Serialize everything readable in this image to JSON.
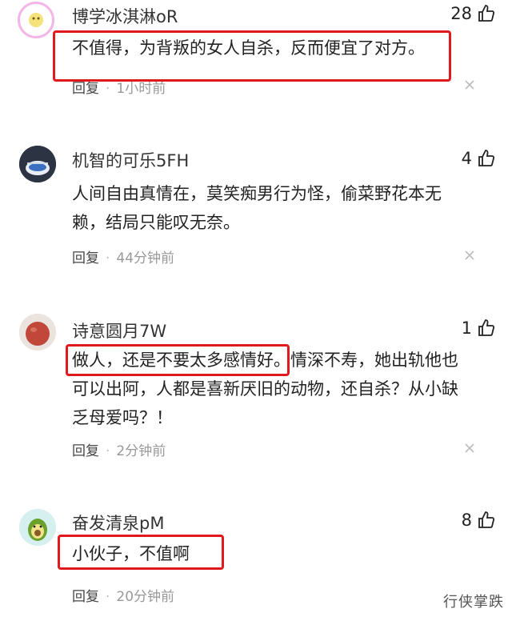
{
  "comments": [
    {
      "username": "博学冰淇淋oR",
      "likes": "28",
      "lines": [
        "不值得，为背叛的女人自杀，反而便宜了对方。"
      ],
      "reply_label": "回复",
      "time": "1小时前"
    },
    {
      "username": "机智的可乐5FH",
      "likes": "4",
      "lines": [
        "人间自由真情在，莫笑痴男行为怪，偷菜野花本无",
        "赖，结局只能叹无奈。"
      ],
      "reply_label": "回复",
      "time": "44分钟前"
    },
    {
      "username": "诗意圆月7W",
      "likes": "1",
      "lines": [
        "做人，还是不要太多感情好。情深不寿，她出轨他也",
        "可以出阿，人都是喜新厌旧的动物，还自杀？从小缺",
        "乏母爱吗？！"
      ],
      "reply_label": "回复",
      "time": "2分钟前"
    },
    {
      "username": "奋发清泉pM",
      "likes": "8",
      "lines": [
        "小伙子，不值啊"
      ],
      "reply_label": "回复",
      "time": "20分钟前"
    }
  ],
  "watermark": "行侠掌跌",
  "colors": {
    "highlight": "#e0191e",
    "text": "#222222",
    "meta": "#999999"
  }
}
